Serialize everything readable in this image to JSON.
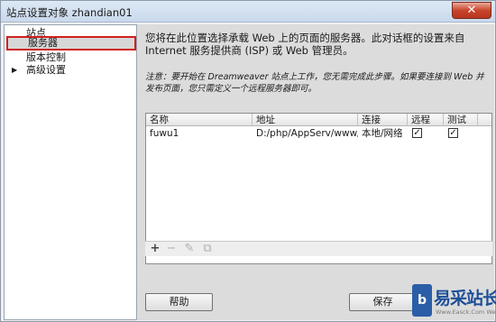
{
  "window": {
    "title": "站点设置对象 zhandian01",
    "close_glyph": "✕"
  },
  "sidebar": {
    "items": [
      {
        "label": "站点",
        "selected": false,
        "expandable": false
      },
      {
        "label": "服务器",
        "selected": true,
        "expandable": false
      },
      {
        "label": "版本控制",
        "selected": false,
        "expandable": false
      },
      {
        "label": "高级设置",
        "selected": false,
        "expandable": true,
        "arrow": "▶"
      }
    ]
  },
  "panel": {
    "description": "您将在此位置选择承载 Web 上的页面的服务器。此对话框的设置来自 Internet 服务提供商 (ISP) 或 Web 管理员。",
    "note": "注意：要开始在 Dreamweaver 站点上工作，您无需完成此步骤。如果要连接到 Web 并发布页面，您只需定义一个远程服务器即可。",
    "table": {
      "columns": [
        "名称",
        "地址",
        "连接",
        "远程",
        "测试"
      ],
      "rows": [
        {
          "name": "fuwu1",
          "address": "D:/php/AppServ/www/M...",
          "connection": "本地/网络",
          "remote": true,
          "test": true
        }
      ]
    },
    "toolbar": {
      "add": "+",
      "remove": "−",
      "edit": "✎",
      "duplicate": "⧉"
    }
  },
  "buttons": {
    "help": "帮助",
    "save": "保存"
  },
  "watermark": {
    "logo_letter": "b",
    "text": "易采站长站",
    "url": "Www.Easck.Com  Webmaster"
  }
}
